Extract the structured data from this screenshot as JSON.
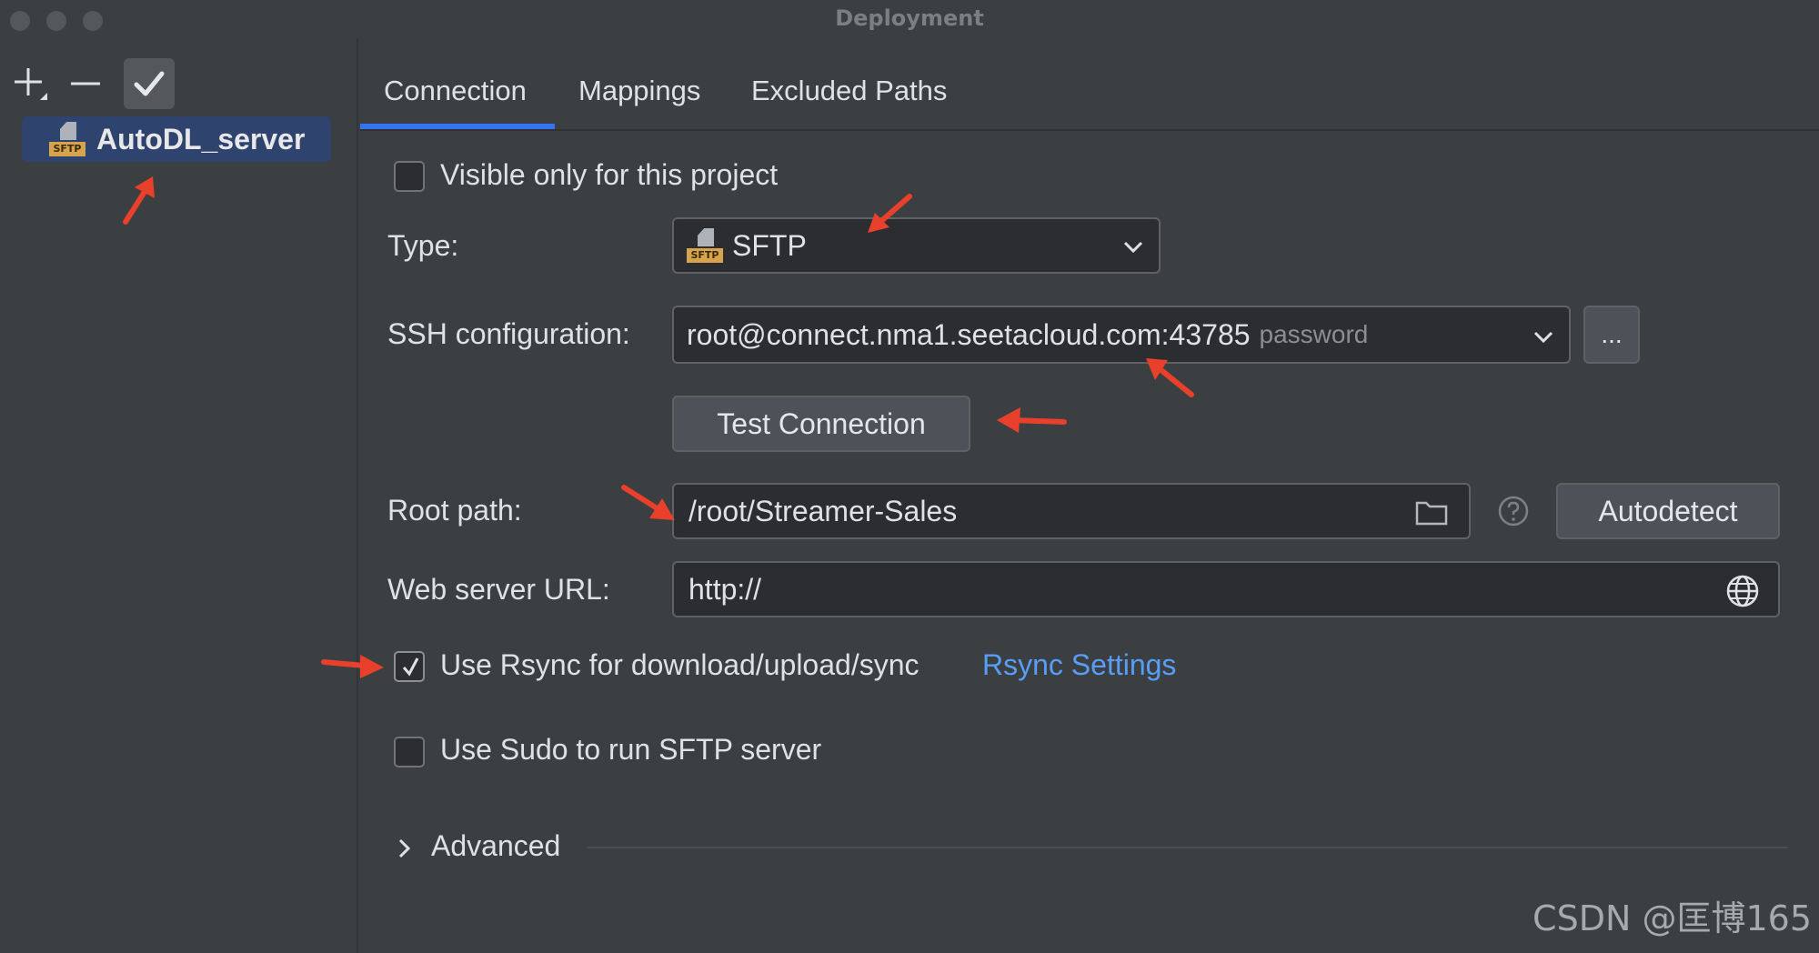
{
  "window": {
    "title": "Deployment"
  },
  "sidebar": {
    "toolbar": {
      "add_icon": "plus-icon",
      "remove_icon": "minus-icon",
      "apply_icon": "checkmark-icon"
    },
    "servers": [
      {
        "label": "AutoDL_server",
        "icon": "sftp-icon",
        "selected": true
      }
    ],
    "sftp_tag": "SFTP"
  },
  "tabs": [
    {
      "label": "Connection",
      "active": true
    },
    {
      "label": "Mappings",
      "active": false
    },
    {
      "label": "Excluded Paths",
      "active": false
    }
  ],
  "form": {
    "visible_only_label": "Visible only for this project",
    "visible_only_checked": false,
    "type_label": "Type:",
    "type_value": "SFTP",
    "ssh_label": "SSH configuration:",
    "ssh_value": "root@connect.nma1.seetacloud.com:43785",
    "ssh_auth": "password",
    "ssh_more_button": "...",
    "test_connection_button": "Test Connection",
    "root_path_label": "Root path:",
    "root_path_value": "/root/Streamer-Sales",
    "autodetect_button": "Autodetect",
    "web_url_label": "Web server URL:",
    "web_url_value": "http://",
    "rsync_label": "Use Rsync for download/upload/sync",
    "rsync_checked": true,
    "rsync_settings_link": "Rsync Settings",
    "sudo_label": "Use Sudo to run SFTP server",
    "sudo_checked": false,
    "advanced_label": "Advanced"
  },
  "watermark": "CSDN @匡博165",
  "colors": {
    "accent": "#3574f0",
    "link": "#589df6",
    "annotation_arrow": "#e8402a",
    "selection": "#2e436e"
  }
}
